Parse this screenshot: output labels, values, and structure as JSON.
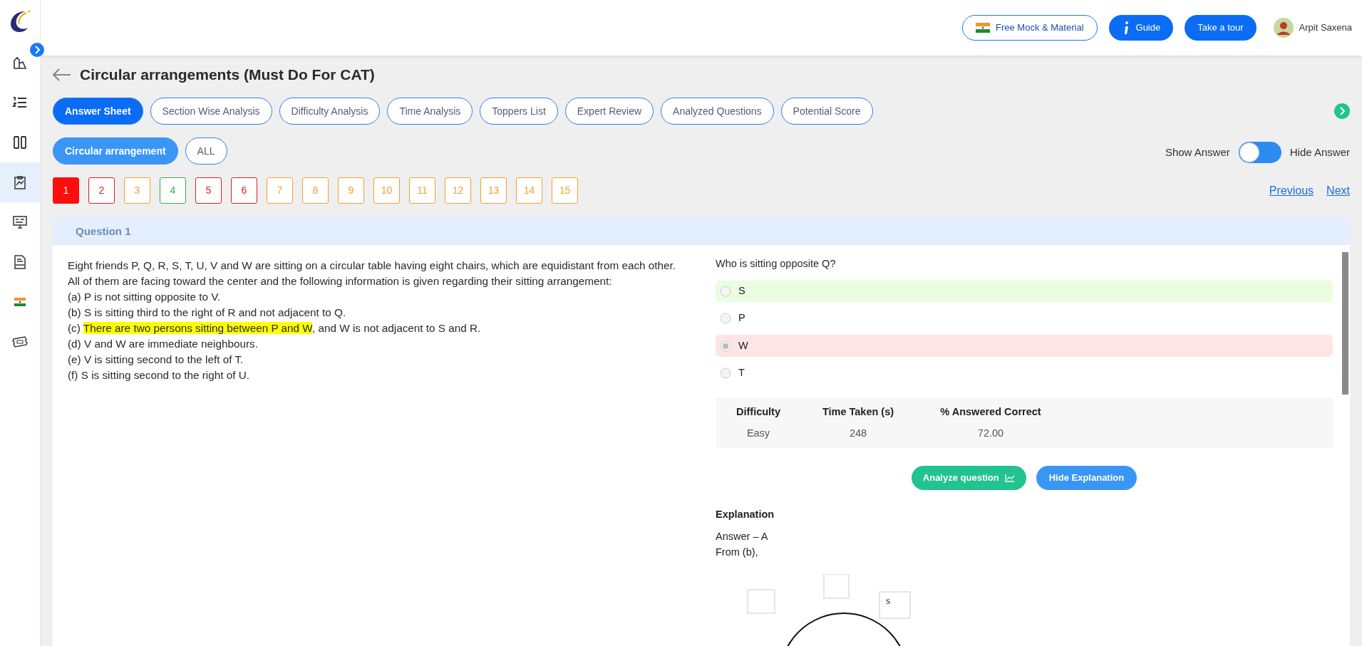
{
  "sidebar": {
    "items": [
      {
        "kind": "books",
        "selected": false
      },
      {
        "kind": "list",
        "selected": false
      },
      {
        "kind": "columns",
        "selected": false
      },
      {
        "kind": "clipboard",
        "selected": true
      },
      {
        "kind": "monitor",
        "selected": false
      },
      {
        "kind": "ebook",
        "selected": false
      },
      {
        "kind": "flag",
        "selected": false
      },
      {
        "kind": "ticket",
        "selected": false
      }
    ]
  },
  "header": {
    "buttons": [
      {
        "kind": "flag",
        "label": "Free Mock & Material"
      },
      {
        "kind": "info",
        "label": "Guide"
      },
      {
        "kind": "plain",
        "label": "Take a tour"
      }
    ],
    "user": "Arpit Saxena"
  },
  "title": "Circular arrangements (Must Do For CAT)",
  "tabs": [
    {
      "label": "Answer Sheet",
      "selected": true
    },
    {
      "label": "Section Wise Analysis",
      "selected": false
    },
    {
      "label": "Difficulty Analysis",
      "selected": false
    },
    {
      "label": "Time Analysis",
      "selected": false
    },
    {
      "label": "Toppers List",
      "selected": false
    },
    {
      "label": "Expert Review",
      "selected": false
    },
    {
      "label": "Analyzed Questions",
      "selected": false
    },
    {
      "label": "Potential Score",
      "selected": false
    }
  ],
  "sections": [
    {
      "label": "Circular arrangement",
      "selected": true
    },
    {
      "label": "ALL",
      "selected": false
    }
  ],
  "answer_toggle": {
    "left_label": "Show Answer",
    "right_label": "Hide Answer",
    "on": false
  },
  "questions": [
    {
      "number": "1",
      "kind": "current"
    },
    {
      "number": "2",
      "kind": "wrong"
    },
    {
      "number": "3",
      "kind": "skipped"
    },
    {
      "number": "4",
      "kind": "correct"
    },
    {
      "number": "5",
      "kind": "wrong"
    },
    {
      "number": "6",
      "kind": "wrong"
    },
    {
      "number": "7",
      "kind": "skipped"
    },
    {
      "number": "8",
      "kind": "skipped"
    },
    {
      "number": "9",
      "kind": "skipped"
    },
    {
      "number": "10",
      "kind": "skipped"
    },
    {
      "number": "11",
      "kind": "skipped"
    },
    {
      "number": "12",
      "kind": "skipped"
    },
    {
      "number": "13",
      "kind": "skipped"
    },
    {
      "number": "14",
      "kind": "skipped"
    },
    {
      "number": "15",
      "kind": "skipped"
    }
  ],
  "pager": {
    "previous": "Previous",
    "next": "Next"
  },
  "question": {
    "heading": "Question 1",
    "passage": [
      [
        {
          "text": "Eight friends P, Q, R, S, T, U, V and W are sitting on a circular table having eight chairs, which are equidistant from each other. All of them are facing toward the center and the following information is given regarding their sitting arrangement:",
          "highlighted": false
        }
      ],
      [
        {
          "text": "(a) P is not sitting opposite to V.",
          "highlighted": false
        }
      ],
      [
        {
          "text": "(b) S is sitting third to the right of R and not adjacent to Q.",
          "highlighted": false
        }
      ],
      [
        {
          "text": "(c) ",
          "highlighted": false
        },
        {
          "text": "There are two persons sitting between P and W",
          "highlighted": true
        },
        {
          "text": ", and W is not adjacent to S and R.",
          "highlighted": false
        }
      ],
      [
        {
          "text": "(d) V and W are immediate neighbours.",
          "highlighted": false
        }
      ],
      [
        {
          "text": "(e) V is sitting second to the left of T.",
          "highlighted": false
        }
      ],
      [
        {
          "text": "(f) S is sitting second to the right of U.",
          "highlighted": false
        }
      ]
    ],
    "prompt": "Who is sitting opposite Q?",
    "options": [
      {
        "label": "S",
        "kind": "correct",
        "selected": false
      },
      {
        "label": "P",
        "kind": "none",
        "selected": false
      },
      {
        "label": "W",
        "kind": "wrong",
        "selected": true
      },
      {
        "label": "T",
        "kind": "none",
        "selected": false
      }
    ],
    "stats": {
      "columns": [
        "Difficulty",
        "Time Taken (s)",
        "% Answered Correct"
      ],
      "values": [
        "Easy",
        "248",
        "72.00"
      ]
    },
    "actions": [
      {
        "kind": "analyze",
        "label": "Analyze question"
      },
      {
        "kind": "toggle",
        "label": "Hide Explanation"
      }
    ],
    "explanation": {
      "heading": "Explanation",
      "lines": [
        "Answer – A",
        "From (b),"
      ],
      "seat_label": "S"
    }
  }
}
